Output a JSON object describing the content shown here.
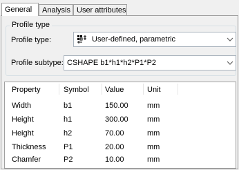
{
  "tabs": [
    {
      "label": "General"
    },
    {
      "label": "Analysis"
    },
    {
      "label": "User attributes"
    }
  ],
  "profile_type_group": {
    "legend": "Profile type",
    "type_label": "Profile type:",
    "type_value": "User-defined, parametric",
    "subtype_label": "Profile subtype:",
    "subtype_value": "CSHAPE b1*h1*h2*P1*P2"
  },
  "properties": {
    "headers": {
      "property": "Property",
      "symbol": "Symbol",
      "value": "Value",
      "unit": "Unit"
    },
    "rows": [
      {
        "property": "Width",
        "symbol": "b1",
        "value": "150.00",
        "unit": "mm"
      },
      {
        "property": "Height",
        "symbol": "h1",
        "value": "300.00",
        "unit": "mm"
      },
      {
        "property": "Height",
        "symbol": "h2",
        "value": "70.00",
        "unit": "mm"
      },
      {
        "property": "Thickness",
        "symbol": "P1",
        "value": "20.00",
        "unit": "mm"
      },
      {
        "property": "Chamfer",
        "symbol": "P2",
        "value": "10.00",
        "unit": "mm"
      }
    ]
  }
}
